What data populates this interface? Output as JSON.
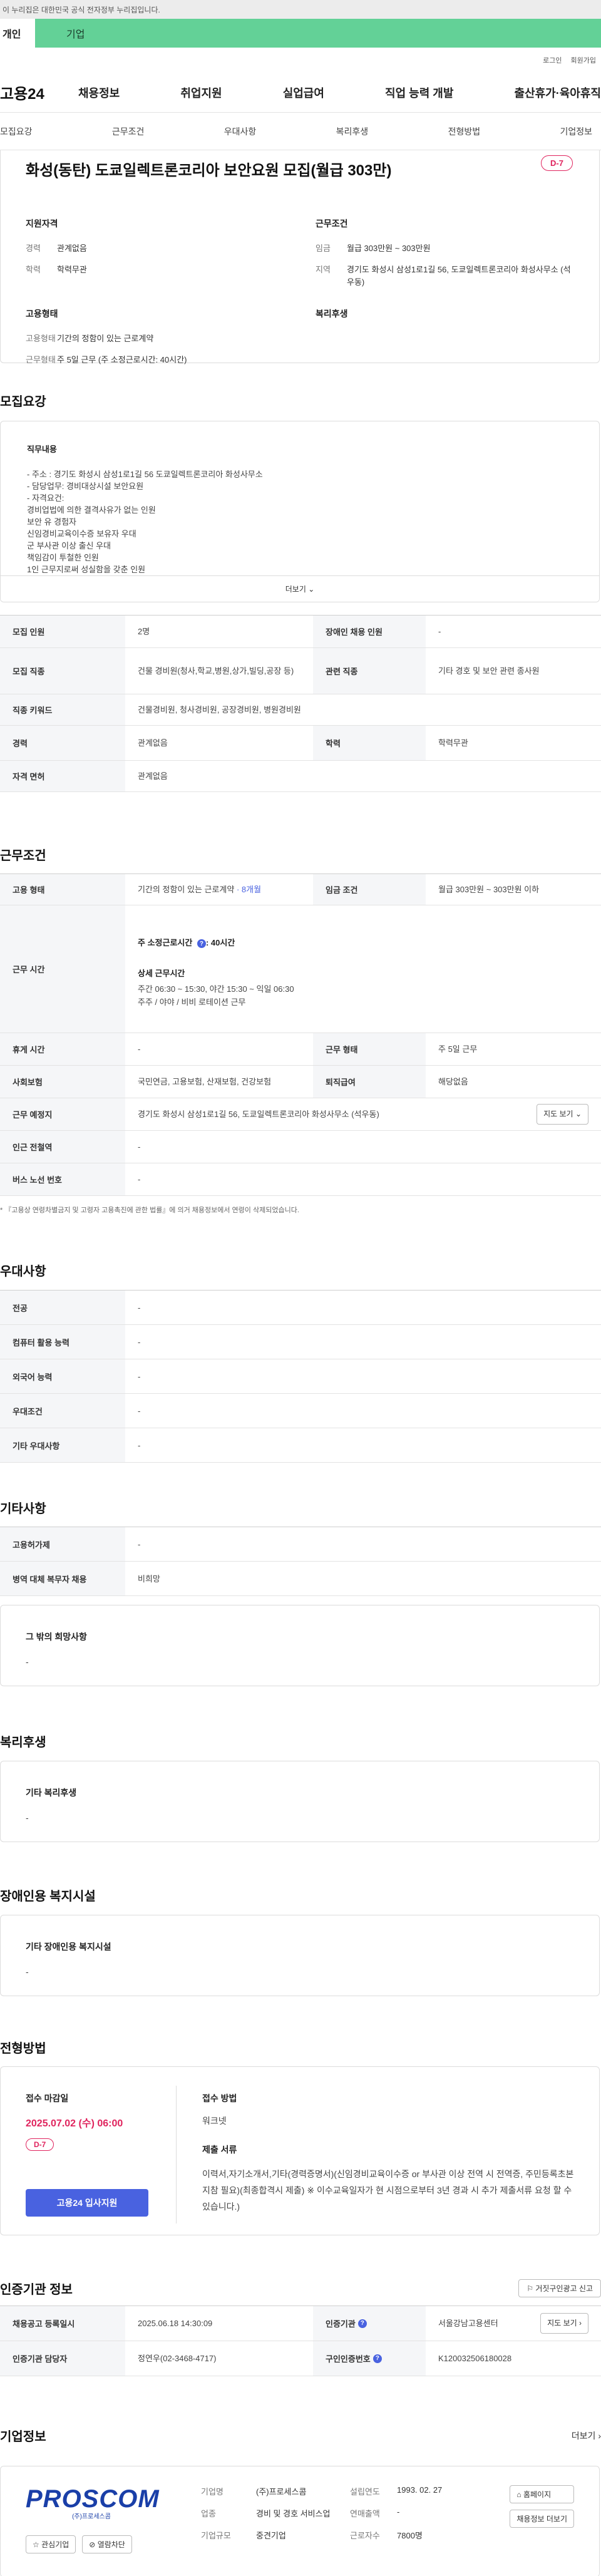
{
  "gov_banner": "이 누리집은 대한민국 공식 전자정부 누리집입니다.",
  "user_tabs": {
    "personal": "개인",
    "corporate": "기업"
  },
  "util_links": [
    "로그인",
    "회원가입"
  ],
  "logo": "고용24",
  "gnb": [
    "채용정보",
    "취업지원",
    "실업급여",
    "직업 능력 개발",
    "출산휴가·육아휴직"
  ],
  "anchor_nav": [
    "모집요강",
    "근무조건",
    "우대사항",
    "복리후생",
    "전형방법",
    "기업정보"
  ],
  "summary": {
    "title": "화성(동탄) 도쿄일렉트론코리아 보안요원 모집(월급 303만)",
    "dday": "D-7",
    "qual_head": "지원자격",
    "cond_head": "근무조건",
    "career_k": "경력",
    "career_v": "관계없음",
    "edu_k": "학력",
    "edu_v": "학력무관",
    "pay_k": "임금",
    "pay_v": "월급 303만원 ~ 303만원",
    "area_k": "지역",
    "area_v": "경기도 화성시 삼성1로1길 56, 도쿄일렉트론코리아 화성사무소 (석우동)",
    "emp_head": "고용형태",
    "welfare_head": "복리후생",
    "emp_type_k": "고용형태",
    "emp_type_v": "기간의 정함이 있는 근로계약",
    "work_k": "근무형태",
    "work_v": "주 5일 근무 (주 소정근로시간: 40시간)"
  },
  "sections": {
    "recruit": "모집요강",
    "conditions": "근무조건",
    "preference": "우대사항",
    "etc": "기타사항",
    "welfare": "복리후생",
    "disability": "장애인용 복지시설",
    "selection": "전형방법",
    "cert": "인증기관 정보",
    "company": "기업정보"
  },
  "duty": {
    "label": "직무내용",
    "lines": [
      "- 주소 : 경기도 화성시 삼성1로1길 56 도쿄일렉트론코리아 화성사무소",
      "- 담당업무: 경비대상시설 보안요원",
      "- 자격요건:",
      "경비업법에 의한 결격사유가 없는 인원",
      "보안 유 경험자",
      "신임경비교육이수증 보유자 우대",
      "군 부사관 이상 출신 우대",
      "책임감이 투철한 인원",
      "1인 근무지로써 성실함을 갖춘 인원"
    ],
    "more": "더보기"
  },
  "recruit_table": {
    "headcount_k": "모집 인원",
    "headcount_v": "2명",
    "disabled_k": "장애인 채용 인원",
    "disabled_v": "-",
    "job_k": "모집 직종",
    "job_v": "건물 경비원(청사,학교,병원,상가,빌딩,공장 등)",
    "related_k": "관련 직종",
    "related_v": "기타 경호 및 보안 관련 종사원",
    "keyword_k": "직종 키워드",
    "keyword_v": "건물경비원, 청사경비원, 공장경비원, 병원경비원",
    "career_k": "경력",
    "career_v": "관계없음",
    "edu_k": "학력",
    "edu_v": "학력무관",
    "license_k": "자격 면허",
    "license_v": "관계없음"
  },
  "cond_table": {
    "emp_k": "고용 형태",
    "emp_v": "기간의 정함이 있는 근로계약",
    "emp_months": "· 8개월",
    "pay_k": "임금 조건",
    "pay_v": "월급 303만원 ~ 303만원 이하",
    "hours_k": "근무 시간",
    "hours_weekly": "주 소정근로시간",
    "hours_weekly_v": ": 40시간",
    "hours_detail_label": "상세 근무시간",
    "hours_detail_1": "주간 06:30 ~ 15:30, 야간 15:30 ~ 익일 06:30",
    "hours_detail_2": "주주 / 야야 / 비비 로테이션 근무",
    "rest_k": "휴게 시간",
    "rest_v": "-",
    "worktype_k": "근무 형태",
    "worktype_v": "주 5일 근무",
    "insurance_k": "사회보험",
    "insurance_v": "국민연금, 고용보험, 산재보험, 건강보험",
    "severance_k": "퇴직급여",
    "severance_v": "해당없음",
    "place_k": "근무 예정지",
    "place_v": "경기도 화성시 삼성1로1길 56, 도쿄일렉트론코리아 화성사무소 (석우동)",
    "map_btn": "지도 보기",
    "subway_k": "인근 전철역",
    "subway_v": "-",
    "bus_k": "버스 노선 번호",
    "bus_v": "-"
  },
  "cond_note": "* 『고용상 연령차별금지 및 고령자 고용촉진에 관한 법률』에 의거 채용정보에서 연령이 삭제되었습니다.",
  "pref_table": {
    "major_k": "전공",
    "major_v": "-",
    "computer_k": "컴퓨터 활용 능력",
    "computer_v": "-",
    "lang_k": "외국어 능력",
    "lang_v": "-",
    "cond_k": "우대조건",
    "cond_v": "-",
    "etc_k": "기타 우대사항",
    "etc_v": "-"
  },
  "etc_table": {
    "emp_ins_k": "고용허가제",
    "emp_ins_v": "-",
    "mil_k": "병역 대체 복무자 채용",
    "mil_v": "비희망"
  },
  "etc_wish": {
    "label": "그 밖의 희망사항",
    "value": "-"
  },
  "welfare_box": {
    "label": "기타 복리후생",
    "value": "-"
  },
  "disability_box": {
    "label": "기타 장애인용 복지시설",
    "value": "-"
  },
  "apply": {
    "deadline_label": "접수 마감일",
    "deadline": "2025.07.02 (수) 06:00",
    "dday": "D-7",
    "btn": "고용24 입사지원",
    "method_label": "접수 방법",
    "method": "워크넷",
    "docs_label": "제출 서류",
    "docs": "이력서,자기소개서,기타(경력증명서)(신임경비교육이수증 or 부사관 이상 전역 시 전역증, 주민등록초본 지참 필요)(최종합격시 제출) ※ 이수교육일자가 현 시점으로부터 3년 경과 시 추가 제출서류 요청 할 수 있습니다.)"
  },
  "cert_btn": "거짓구인광고 신고",
  "cert_table": {
    "reg_k": "채용공고 등록일시",
    "reg_v": "2025.06.18 14:30:09",
    "org_k": "인증기관",
    "org_v": "서울강남고용센터",
    "map_btn": "지도 보기",
    "mgr_k": "인증기관 담당자",
    "mgr_v": "정연우(02-3468-4717)",
    "no_k": "구인인증번호",
    "no_v": "K120032506180028"
  },
  "company": {
    "more": "더보기",
    "logo_text": "PROSCOM",
    "logo_sub": "(주)프로세스콤",
    "fav_btn": "관심기업",
    "block_btn": "열람차단",
    "name_k": "기업명",
    "name_v": "(주)프로세스콤",
    "found_k": "설립연도",
    "found_v": "1993. 02. 27",
    "industry_k": "업종",
    "industry_v": "경비 및 경호 서비스업",
    "sales_k": "연매출액",
    "sales_v": "-",
    "size_k": "기업규모",
    "size_v": "중견기업",
    "staff_k": "근로자수",
    "staff_v": "7800명",
    "homepage_btn": "홈페이지",
    "other_btn": "채용정보 더보기"
  }
}
